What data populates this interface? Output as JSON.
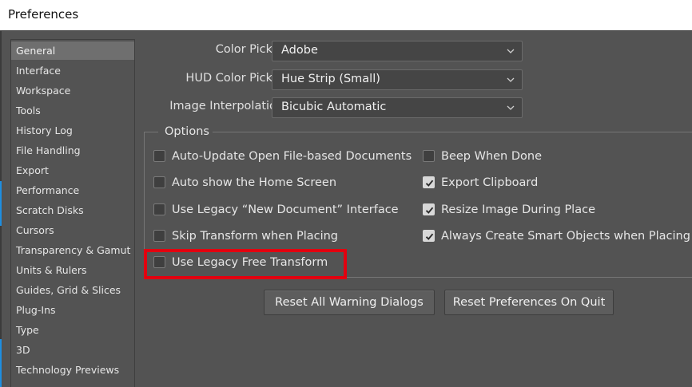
{
  "window": {
    "title": "Preferences"
  },
  "sidebar": {
    "items": [
      {
        "label": "General",
        "selected": true
      },
      {
        "label": "Interface"
      },
      {
        "label": "Workspace"
      },
      {
        "label": "Tools"
      },
      {
        "label": "History Log"
      },
      {
        "label": "File Handling"
      },
      {
        "label": "Export"
      },
      {
        "label": "Performance"
      },
      {
        "label": "Scratch Disks"
      },
      {
        "label": "Cursors"
      },
      {
        "label": "Transparency & Gamut"
      },
      {
        "label": "Units & Rulers"
      },
      {
        "label": "Guides, Grid & Slices"
      },
      {
        "label": "Plug-Ins"
      },
      {
        "label": "Type"
      },
      {
        "label": "3D"
      },
      {
        "label": "Technology Previews"
      }
    ]
  },
  "fields": {
    "color_picker": {
      "label": "Color Picker:",
      "value": "Adobe"
    },
    "hud_color_picker": {
      "label": "HUD Color Picker:",
      "value": "Hue Strip (Small)"
    },
    "image_interpolation": {
      "label": "Image Interpolation:",
      "value": "Bicubic Automatic"
    }
  },
  "options": {
    "title": "Options",
    "left": [
      {
        "label": "Auto-Update Open File-based Documents",
        "checked": false
      },
      {
        "label": "Auto show the Home Screen",
        "checked": false
      },
      {
        "label": "Use Legacy “New Document” Interface",
        "checked": false
      },
      {
        "label": "Skip Transform when Placing",
        "checked": false
      },
      {
        "label": "Use Legacy Free Transform",
        "checked": false
      }
    ],
    "right": [
      {
        "label": "Beep When Done",
        "checked": false
      },
      {
        "label": "Export Clipboard",
        "checked": true
      },
      {
        "label": "Resize Image During Place",
        "checked": true
      },
      {
        "label": "Always Create Smart Objects when Placing",
        "checked": true
      }
    ]
  },
  "buttons": {
    "reset_warnings": "Reset All Warning Dialogs",
    "reset_prefs": "Reset Preferences On Quit"
  },
  "colors": {
    "background": "#535353",
    "highlight": "#e2000f",
    "selected_item": "#6f6f6f"
  }
}
